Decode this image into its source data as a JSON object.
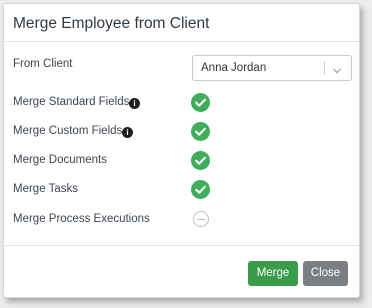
{
  "dialog": {
    "title": "Merge Employee from Client"
  },
  "from_client": {
    "label": "From Client",
    "selected": "Anna Jordan"
  },
  "options": [
    {
      "label": "Merge Standard Fields",
      "status": "checked",
      "info": true
    },
    {
      "label": "Merge Custom Fields",
      "status": "checked",
      "info": true
    },
    {
      "label": "Merge Documents",
      "status": "checked",
      "info": false
    },
    {
      "label": "Merge Tasks",
      "status": "checked",
      "info": false
    },
    {
      "label": "Merge Process Executions",
      "status": "unchecked",
      "info": false
    }
  ],
  "icons": {
    "info": "info-icon",
    "check": "check-circle-icon",
    "empty": "empty-circle-icon",
    "dropdown": "chevron-down-icon"
  },
  "buttons": {
    "merge_label": "Merge",
    "close_label": "Close"
  },
  "colors": {
    "check_green": "#40ad5b",
    "merge_button": "#3a9b4a",
    "close_button": "#7b7f84"
  }
}
